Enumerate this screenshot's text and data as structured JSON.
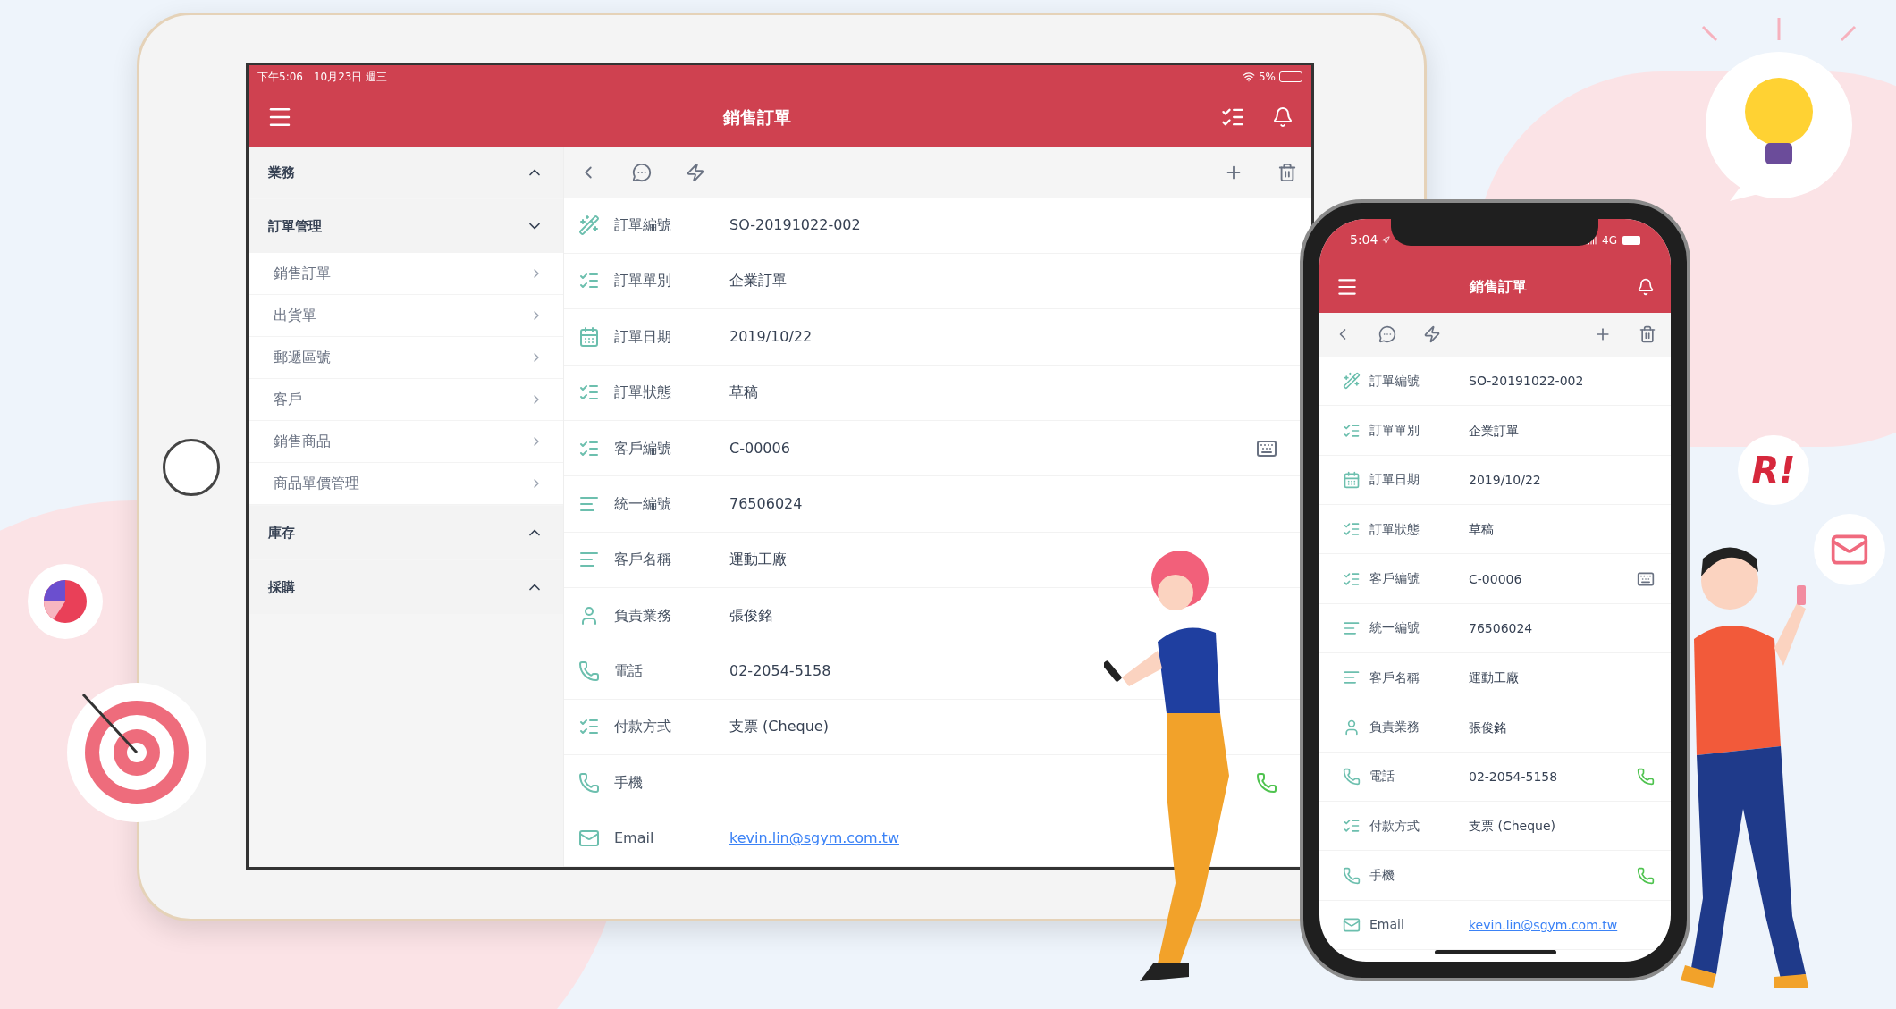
{
  "tablet": {
    "status_bar": {
      "time": "下午5:06",
      "date": "10月23日 週三",
      "battery": "5%"
    },
    "header": {
      "title": "銷售訂單"
    },
    "sidebar": {
      "groups": [
        {
          "label": "業務",
          "expanded": false
        },
        {
          "label": "訂單管理",
          "expanded": true,
          "items": [
            "銷售訂單",
            "出貨單",
            "郵遞區號",
            "客戶",
            "銷售商品",
            "商品單價管理"
          ]
        },
        {
          "label": "庫存",
          "expanded": false
        },
        {
          "label": "採購",
          "expanded": false
        }
      ]
    },
    "fields": [
      {
        "kind": "number",
        "label": "訂單編號",
        "value": "SO-20191022-002"
      },
      {
        "kind": "choice",
        "label": "訂單單別",
        "value": "企業訂單"
      },
      {
        "kind": "date",
        "label": "訂單日期",
        "value": "2019/10/22"
      },
      {
        "kind": "choice",
        "label": "訂單狀態",
        "value": "草稿"
      },
      {
        "kind": "choice",
        "label": "客戶編號",
        "value": "C-00006",
        "keyboard": true
      },
      {
        "kind": "text",
        "label": "統一編號",
        "value": "76506024"
      },
      {
        "kind": "text",
        "label": "客戶名稱",
        "value": "運動工廠"
      },
      {
        "kind": "person",
        "label": "負責業務",
        "value": "張俊銘"
      },
      {
        "kind": "phone",
        "label": "電話",
        "value": "02-2054-5158"
      },
      {
        "kind": "choice",
        "label": "付款方式",
        "value": "支票 (Cheque)"
      },
      {
        "kind": "phone",
        "label": "手機",
        "call": true
      },
      {
        "kind": "email",
        "label": "Email",
        "value": "kevin.lin@sgym.com.tw"
      }
    ]
  },
  "phone": {
    "status_bar": {
      "time": "5:04",
      "network": "4G"
    },
    "header": {
      "title": "銷售訂單"
    },
    "fields": [
      {
        "kind": "number",
        "label": "訂單編號",
        "value": "SO-20191022-002"
      },
      {
        "kind": "choice",
        "label": "訂單單別",
        "value": "企業訂單"
      },
      {
        "kind": "date",
        "label": "訂單日期",
        "value": "2019/10/22"
      },
      {
        "kind": "choice",
        "label": "訂單狀態",
        "value": "草稿"
      },
      {
        "kind": "choice",
        "label": "客戶編號",
        "value": "C-00006",
        "keyboard": true
      },
      {
        "kind": "text",
        "label": "統一編號",
        "value": "76506024"
      },
      {
        "kind": "text",
        "label": "客戶名稱",
        "value": "運動工廠"
      },
      {
        "kind": "person",
        "label": "負責業務",
        "value": "張俊銘"
      },
      {
        "kind": "phone",
        "label": "電話",
        "value": "02-2054-5158",
        "call": true
      },
      {
        "kind": "choice",
        "label": "付款方式",
        "value": "支票 (Cheque)"
      },
      {
        "kind": "phone",
        "label": "手機",
        "call": true
      },
      {
        "kind": "email",
        "label": "Email",
        "value": "kevin.lin@sgym.com.tw"
      }
    ]
  },
  "badge": {
    "text": "R!"
  }
}
